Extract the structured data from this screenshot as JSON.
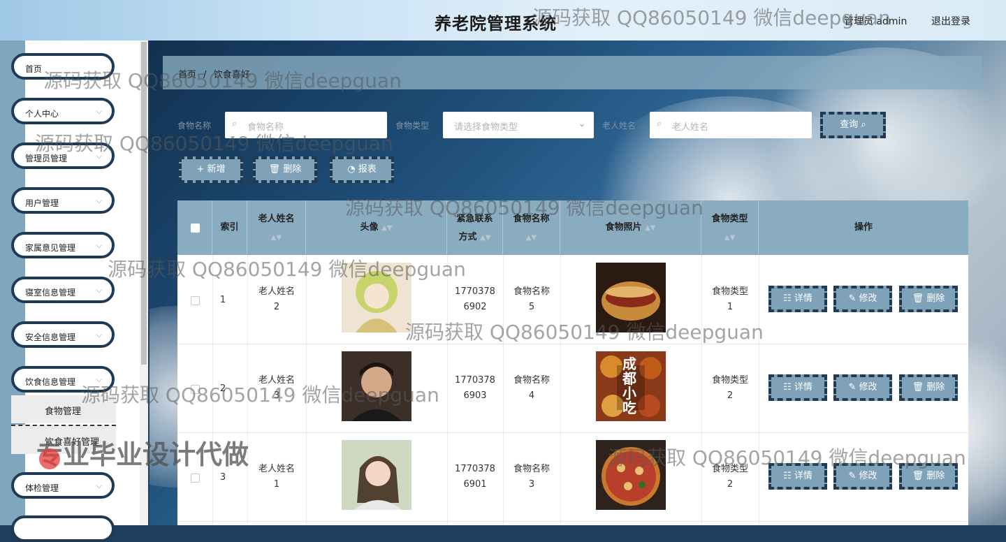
{
  "header": {
    "title": "养老院管理系统",
    "user_label": "管理员 admin",
    "logout_label": "退出登录"
  },
  "sidebar": {
    "items": [
      {
        "label": "首页",
        "has_chevron": false
      },
      {
        "label": "个人中心",
        "has_chevron": true
      },
      {
        "label": "管理员管理",
        "has_chevron": true
      },
      {
        "label": "用户管理",
        "has_chevron": true
      },
      {
        "label": "家属意见管理",
        "has_chevron": true
      },
      {
        "label": "寝室信息管理",
        "has_chevron": true
      },
      {
        "label": "安全信息管理",
        "has_chevron": true
      },
      {
        "label": "饮食信息管理",
        "has_chevron": true
      },
      {
        "label": "体检管理",
        "has_chevron": true
      }
    ],
    "submenu": [
      {
        "label": "食物管理"
      },
      {
        "label": "饮食喜好管理"
      }
    ]
  },
  "breadcrumb": {
    "home": "首页",
    "separator": "/",
    "current": "饮食喜好"
  },
  "filters": {
    "food_name_label": "食物名称",
    "food_name_placeholder": "食物名称",
    "food_type_label": "食物类型",
    "food_type_placeholder": "请选择食物类型",
    "elder_name_label": "老人姓名",
    "elder_name_placeholder": "老人姓名",
    "query_label": "查询"
  },
  "toolbar": {
    "add_label": "新增",
    "delete_label": "删除",
    "report_label": "报表"
  },
  "table": {
    "headers": {
      "index": "索引",
      "elder_name": "老人姓名",
      "avatar": "头像",
      "contact_line1": "紧急联系",
      "contact_line2": "方式",
      "food_name": "食物名称",
      "food_photo": "食物照片",
      "food_type": "食物类型",
      "actions": "操作"
    },
    "rows": [
      {
        "index": "1",
        "elder_line1": "老人姓名",
        "elder_line2": "2",
        "phone_line1": "1770378",
        "phone_line2": "6902",
        "food_line1": "食物名称",
        "food_line2": "5",
        "type_line1": "食物类型",
        "type_line2": "1"
      },
      {
        "index": "2",
        "elder_line1": "老人姓名",
        "elder_line2": "3",
        "phone_line1": "1770378",
        "phone_line2": "6903",
        "food_line1": "食物名称",
        "food_line2": "4",
        "type_line1": "食物类型",
        "type_line2": "2"
      },
      {
        "index": "3",
        "elder_line1": "老人姓名",
        "elder_line2": "1",
        "phone_line1": "1770378",
        "phone_line2": "6901",
        "food_line1": "食物名称",
        "food_line2": "3",
        "type_line1": "食物类型",
        "type_line2": "2"
      }
    ],
    "action_labels": {
      "detail": "详情",
      "edit": "修改",
      "delete": "删除"
    },
    "food_photo_caption": "成都小吃"
  },
  "watermarks": {
    "repeat": "源码获取 QQ86050149 微信deepguan",
    "big": "专业毕业设计代做"
  },
  "colors": {
    "accent": "#7fa2b8",
    "border": "#1f3a52",
    "header_bg": "#8aacc1"
  }
}
